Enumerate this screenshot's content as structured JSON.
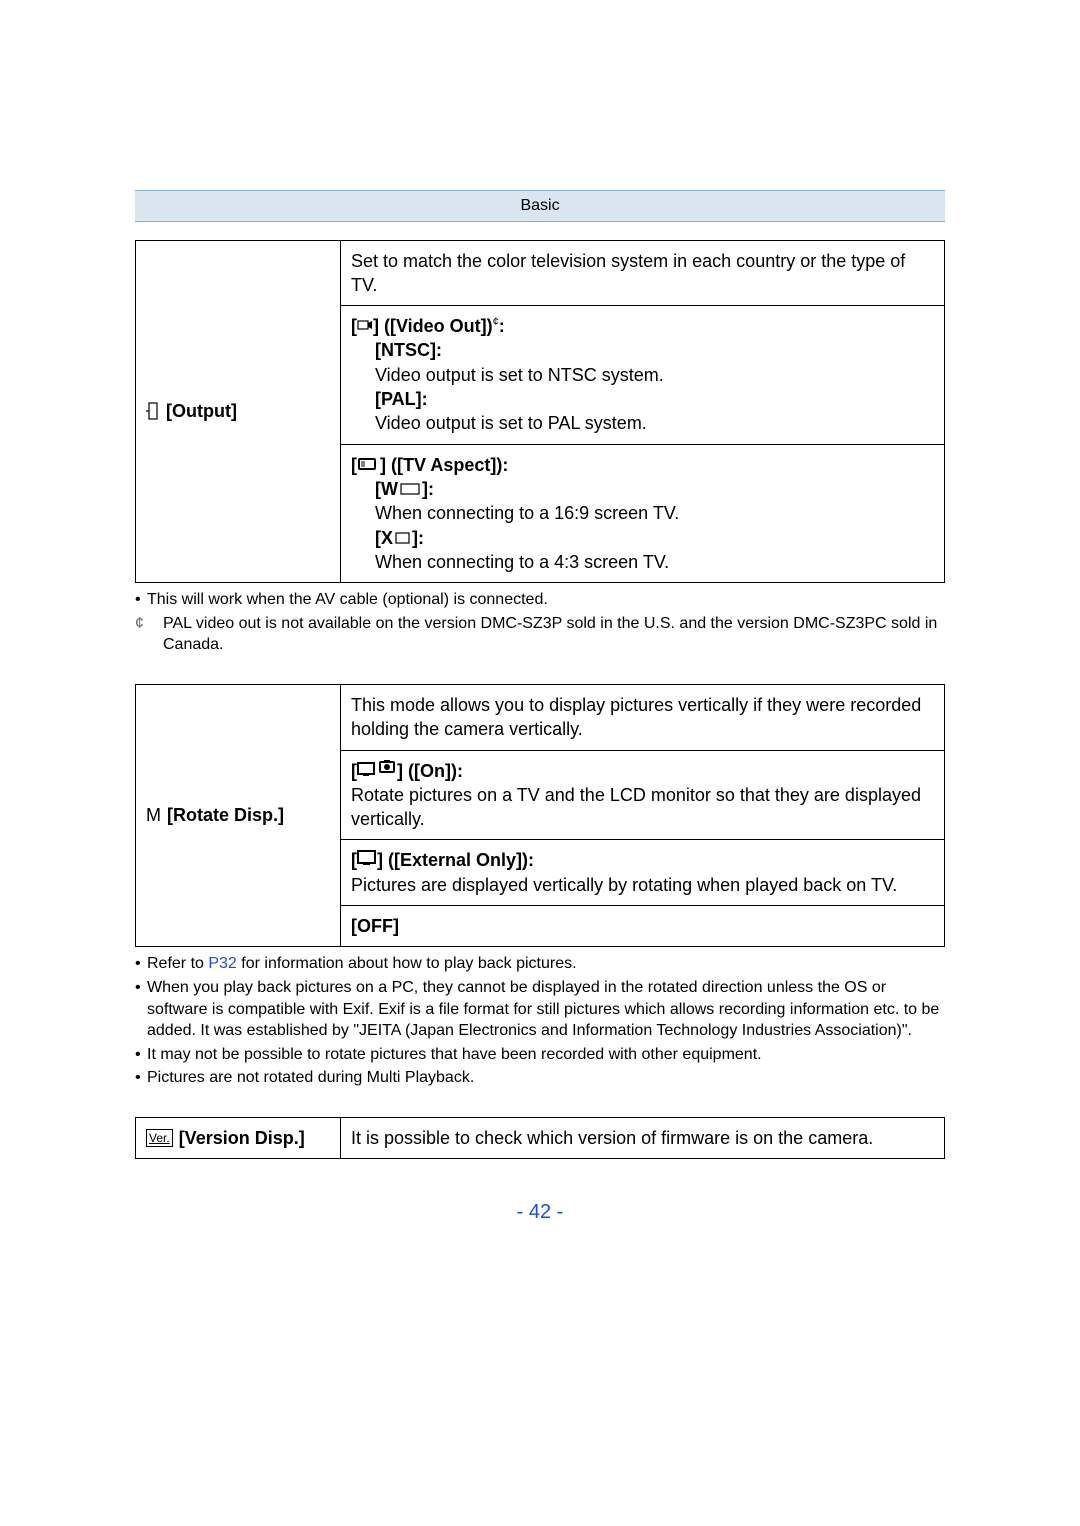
{
  "header": {
    "section": "Basic"
  },
  "output": {
    "icon_name": "output-icon",
    "label": "[Output]",
    "intro": "Set to match the color television system in each country or the type of TV.",
    "video_out": {
      "icon_name": "video-out-icon",
      "heading": "] ([Video Out])",
      "heading_prefix": "[",
      "star": "¢",
      "ntsc_label": "[NTSC]:",
      "ntsc_text": "Video output is set to NTSC system.",
      "pal_label": "[PAL]:",
      "pal_text": "Video output is set to PAL system."
    },
    "tv_aspect": {
      "heading_prefix": "[",
      "icon_name": "tv-aspect-icon",
      "heading": "] ([TV Aspect]):",
      "w_label": "[W",
      "w_label_suffix": "]:",
      "w_text": "When connecting to a 16:9 screen TV.",
      "x_label": "[X",
      "x_label_suffix": "]:",
      "x_text": "When connecting to a 4:3 screen TV."
    },
    "notes": {
      "av": "This will work when the AV cable (optional) is connected.",
      "star": "¢",
      "pal": "PAL video out is not available on the version DMC-SZ3P sold in the U.S. and the version DMC-SZ3PC sold in Canada."
    }
  },
  "rotate": {
    "icon_name": "rotate-icon",
    "label_prefix": "M",
    "label": "[Rotate Disp.]",
    "intro": "This mode allows you to display pictures vertically if they were recorded holding the camera vertically.",
    "on": {
      "icon_name": "rotate-on-icon",
      "heading_prefix": "[",
      "heading": "] ([On]):",
      "text": "Rotate pictures on a TV and the LCD monitor so that they are displayed vertically."
    },
    "ext": {
      "icon_name": "rotate-ext-icon",
      "heading_prefix": "[",
      "heading": "] ([External Only]):",
      "text": "Pictures are displayed vertically by rotating when played back on TV."
    },
    "off": "[OFF]",
    "notes": {
      "p32_a": "Refer to ",
      "p32_link": "P32",
      "p32_b": " for information about how to play back pictures.",
      "pc": "When you play back pictures on a PC, they cannot be displayed in the rotated direction unless the OS or software is compatible with Exif. Exif is a file format for still pictures which allows recording information etc. to be added. It was established by \"JEITA (Japan Electronics and Information Technology Industries Association)\".",
      "other": "It may not be possible to rotate pictures that have been recorded with other equipment.",
      "multi": "Pictures are not rotated during Multi Playback."
    }
  },
  "version": {
    "icon_name": "version-icon",
    "icon_text": "Ver.",
    "label": "[Version Disp.]",
    "text": "It is possible to check which version of firmware is on the camera."
  },
  "page": "- 42 -"
}
